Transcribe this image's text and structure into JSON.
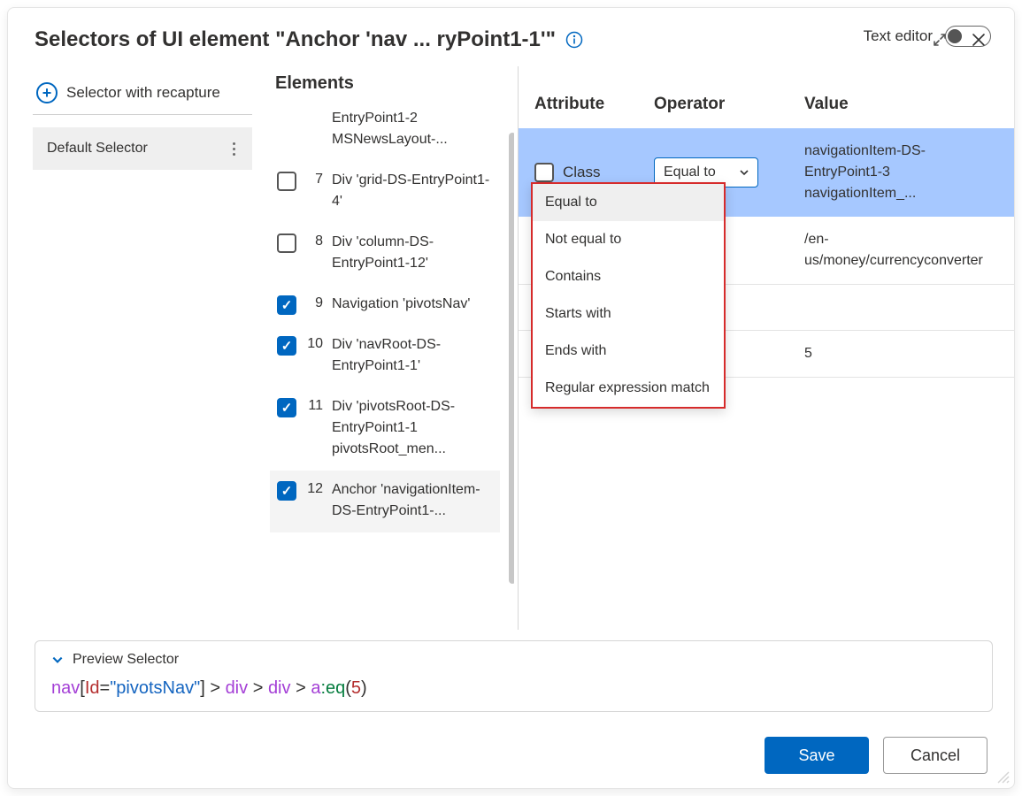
{
  "dialog": {
    "title": "Selectors of UI element \"Anchor 'nav ... ryPoint1-1'\""
  },
  "left": {
    "recapture_label": "Selector with recapture",
    "selector_item_label": "Default Selector"
  },
  "center": {
    "heading": "Elements",
    "rows": {
      "r6": {
        "num": "",
        "label": "EntryPoint1-2 MSNewsLayout-..."
      },
      "r7": {
        "num": "7",
        "label": "Div 'grid-DS-EntryPoint1-4'"
      },
      "r8": {
        "num": "8",
        "label": "Div 'column-DS-EntryPoint1-12'"
      },
      "r9": {
        "num": "9",
        "label": "Navigation 'pivotsNav'"
      },
      "r10": {
        "num": "10",
        "label": "Div 'navRoot-DS-EntryPoint1-1'"
      },
      "r11": {
        "num": "11",
        "label": "Div 'pivotsRoot-DS-EntryPoint1-1 pivotsRoot_men..."
      },
      "r12": {
        "num": "12",
        "label": "Anchor 'navigationItem-DS-EntryPoint1-..."
      }
    }
  },
  "right": {
    "texteditor_label": "Text editor",
    "headers": {
      "attr": "Attribute",
      "op": "Operator",
      "val": "Value"
    },
    "rows": {
      "r0": {
        "attr": "Class",
        "op": "Equal to",
        "val": "navigationItem-DS-EntryPoint1-3 navigationItem_..."
      },
      "r1": {
        "val": "/en-us/money/currencyconverter"
      },
      "r2": {
        "val": ""
      },
      "r3": {
        "val": "5"
      }
    },
    "dropdown": {
      "o0": "Equal to",
      "o1": "Not equal to",
      "o2": "Contains",
      "o3": "Starts with",
      "o4": "Ends with",
      "o5": "Regular expression match"
    }
  },
  "preview": {
    "title": "Preview Selector",
    "tokens": {
      "t0": "nav",
      "t1": "[",
      "t2": "Id",
      "t3": "=",
      "t4": "\"pivotsNav\"",
      "t5": "]",
      "t6": " > ",
      "t7": "div",
      "t8": " > ",
      "t9": "div",
      "t10": " > ",
      "t11": "a",
      "t12": ":eq",
      "t13": "(",
      "t14": "5",
      "t15": ")"
    }
  },
  "footer": {
    "save": "Save",
    "cancel": "Cancel"
  }
}
